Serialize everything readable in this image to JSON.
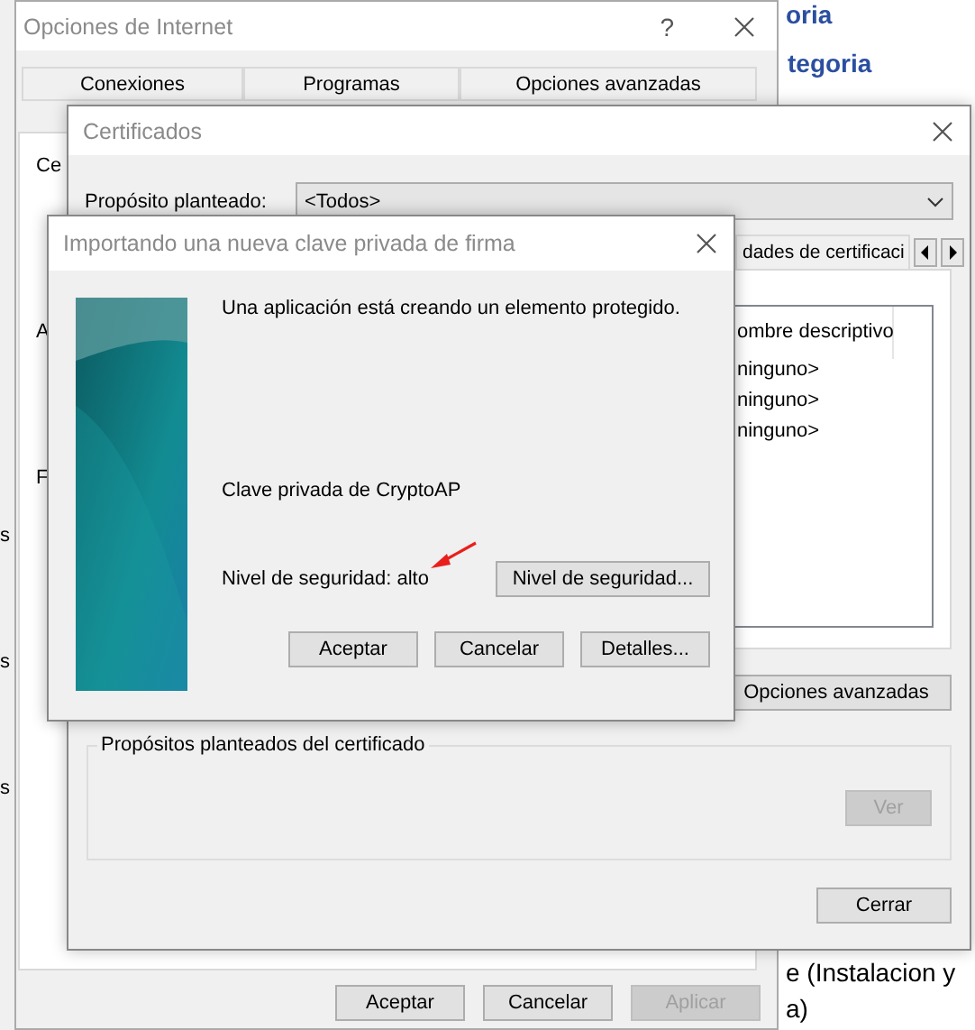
{
  "background_page": {
    "links": [
      "oria",
      "tegoria"
    ],
    "lines": [
      "e (Instalacion y",
      "a)"
    ]
  },
  "left_window": {
    "fragments": [
      "s",
      "s",
      "s"
    ]
  },
  "internet_options": {
    "title": "Opciones de Internet",
    "help": "?",
    "tabs": [
      {
        "label": "Conexiones"
      },
      {
        "label": "Programas"
      },
      {
        "label": "Opciones avanzadas"
      }
    ],
    "panel_fragments": [
      "Ce",
      "A",
      "F"
    ],
    "buttons": [
      {
        "label": "Aceptar",
        "disabled": false
      },
      {
        "label": "Cancelar",
        "disabled": false
      },
      {
        "label": "Aplicar",
        "disabled": true
      }
    ]
  },
  "certificates": {
    "title": "Certificados",
    "purpose_label": "Propósito planteado:",
    "purpose_value": "<Todos>",
    "tab_label": "dades de certificaci",
    "list": {
      "column": "ombre descriptivo",
      "rows": [
        "ninguno>",
        "ninguno>",
        "ninguno>"
      ]
    },
    "advanced_button": {
      "label": "Opciones avanzadas",
      "disabled": false
    },
    "group_title": "Propósitos planteados del certificado",
    "view_button": {
      "label": "Ver",
      "disabled": true
    },
    "close_button": {
      "label": "Cerrar",
      "disabled": false
    }
  },
  "import_dialog": {
    "title": "Importando una nueva clave privada de firma",
    "message": "Una aplicación está creando un elemento protegido.",
    "key_name": "Clave privada de CryptoAP",
    "security_level": "Nivel de seguridad: alto",
    "level_button": {
      "label": "Nivel de seguridad...",
      "disabled": false
    },
    "buttons": [
      {
        "label": "Aceptar",
        "disabled": false
      },
      {
        "label": "Cancelar",
        "disabled": false
      },
      {
        "label": "Detalles...",
        "disabled": false
      }
    ]
  }
}
